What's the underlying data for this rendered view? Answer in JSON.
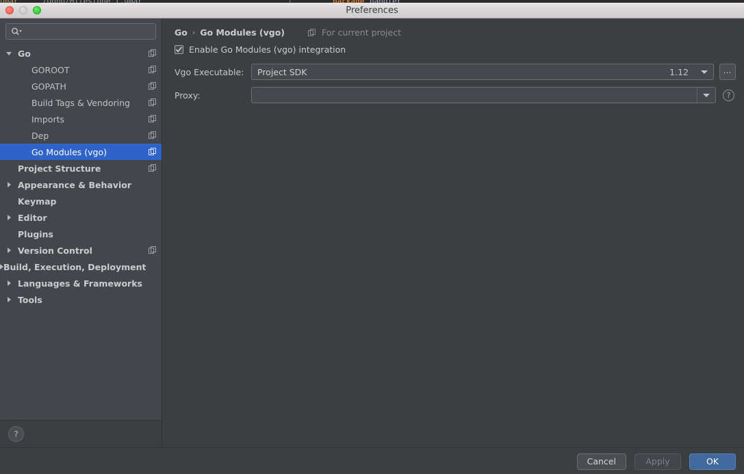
{
  "background": {
    "fragments": [
      "umar",
      "/Dono/Milestone I.umar",
      "}",
      "package",
      "handler"
    ]
  },
  "window": {
    "title": "Preferences",
    "traffic_lights": [
      "close",
      "minimize",
      "maximize"
    ]
  },
  "sidebar": {
    "search": {
      "value": "",
      "placeholder": ""
    },
    "tree": [
      {
        "label": "Go",
        "level": 1,
        "bold": true,
        "arrow": "down",
        "copy": true,
        "selected": false
      },
      {
        "label": "GOROOT",
        "level": 2,
        "bold": false,
        "arrow": "none",
        "copy": true,
        "selected": false
      },
      {
        "label": "GOPATH",
        "level": 2,
        "bold": false,
        "arrow": "none",
        "copy": true,
        "selected": false
      },
      {
        "label": "Build Tags & Vendoring",
        "level": 2,
        "bold": false,
        "arrow": "none",
        "copy": true,
        "selected": false
      },
      {
        "label": "Imports",
        "level": 2,
        "bold": false,
        "arrow": "none",
        "copy": true,
        "selected": false
      },
      {
        "label": "Dep",
        "level": 2,
        "bold": false,
        "arrow": "none",
        "copy": true,
        "selected": false
      },
      {
        "label": "Go Modules (vgo)",
        "level": 2,
        "bold": false,
        "arrow": "none",
        "copy": true,
        "selected": true
      },
      {
        "label": "Project Structure",
        "level": 1,
        "bold": true,
        "arrow": "none",
        "copy": true,
        "selected": false
      },
      {
        "label": "Appearance & Behavior",
        "level": 1,
        "bold": true,
        "arrow": "right",
        "copy": false,
        "selected": false
      },
      {
        "label": "Keymap",
        "level": 1,
        "bold": true,
        "arrow": "none",
        "copy": false,
        "selected": false
      },
      {
        "label": "Editor",
        "level": 1,
        "bold": true,
        "arrow": "right",
        "copy": false,
        "selected": false
      },
      {
        "label": "Plugins",
        "level": 1,
        "bold": true,
        "arrow": "none",
        "copy": false,
        "selected": false
      },
      {
        "label": "Version Control",
        "level": 1,
        "bold": true,
        "arrow": "right",
        "copy": true,
        "selected": false
      },
      {
        "label": "Build, Execution, Deployment",
        "level": 1,
        "bold": true,
        "arrow": "right",
        "copy": false,
        "selected": false
      },
      {
        "label": "Languages & Frameworks",
        "level": 1,
        "bold": true,
        "arrow": "right",
        "copy": false,
        "selected": false
      },
      {
        "label": "Tools",
        "level": 1,
        "bold": true,
        "arrow": "right",
        "copy": false,
        "selected": false
      }
    ],
    "help_label": "?"
  },
  "main": {
    "breadcrumb": {
      "root": "Go",
      "separator": "›",
      "current": "Go Modules (vgo)",
      "scope_label": "For current project"
    },
    "enable_checkbox": {
      "label": "Enable Go Modules (vgo) integration",
      "checked": true,
      "mark": "✓"
    },
    "fields": [
      {
        "label": "Vgo Executable:",
        "value": "Project SDK",
        "extra": "1.12",
        "browse_label": "…"
      },
      {
        "label": "Proxy:",
        "value": "",
        "extra": "",
        "help_label": "?"
      }
    ]
  },
  "footer": {
    "cancel_label": "Cancel",
    "apply_label": "Apply",
    "ok_label": "OK"
  },
  "colors": {
    "selection_blue": "#2f63c9",
    "primary_button": "#41699e",
    "panel_bg": "#3c3f41",
    "sidebar_bg": "#43474b"
  }
}
